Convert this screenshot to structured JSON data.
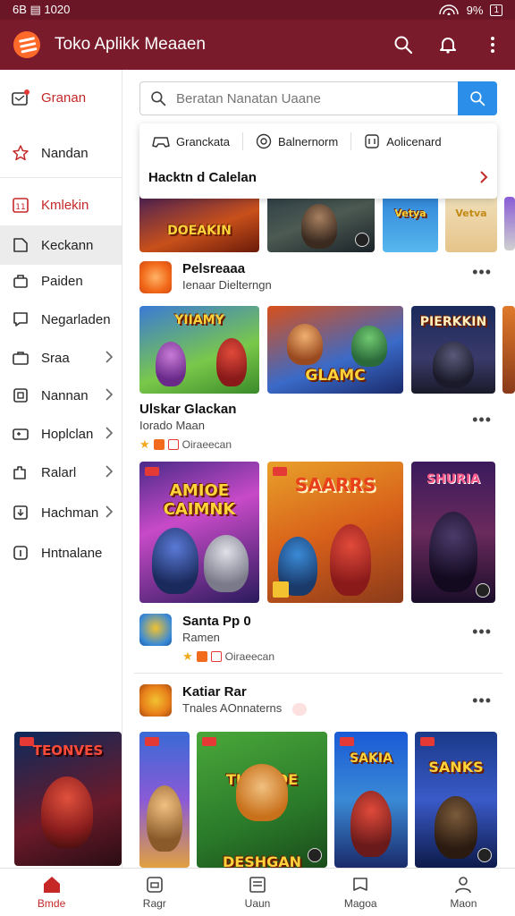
{
  "status": {
    "left": "6B ▤ 1020",
    "battery": "9%",
    "battery_badge": "1"
  },
  "app": {
    "title": "Toko Aplikk Meaaen"
  },
  "sidebar": {
    "items": [
      {
        "label": "Granan"
      },
      {
        "label": "Nandan"
      },
      {
        "label": "Kmlekin"
      },
      {
        "label": "Keckann"
      },
      {
        "label": "Paiden"
      },
      {
        "label": "Negarladen"
      },
      {
        "label": "Sraa"
      },
      {
        "label": "Nannan"
      },
      {
        "label": "Hoplclan"
      },
      {
        "label": "Ralarl"
      },
      {
        "label": "Hachman"
      },
      {
        "label": "Hntnalane"
      }
    ],
    "promo_title": "TEONVES"
  },
  "search": {
    "placeholder": "Beratan Nanatan Uaane"
  },
  "dropdown": {
    "chips": [
      "Granckata",
      "Balnernorm",
      "Aolicenard"
    ],
    "link": "Hacktn d Calelan"
  },
  "tiles": {
    "row1": [
      "DOEAKIN",
      "",
      "Vetya",
      "Vetva"
    ],
    "row2": [
      "YIIAMY",
      "GLAMC",
      "PIERKKIN",
      ""
    ],
    "row3": [
      "AMIOE CAIMNK",
      "SAARRS",
      "SHURIA"
    ],
    "row4": [
      "",
      "TKONIOE DESHGAN",
      "SAKIA",
      "SANKS"
    ]
  },
  "apps": [
    {
      "name": "Pelsreaaa",
      "sub": "Ienaar Dielterngn",
      "rating": ""
    },
    {
      "name": "Ulskar Glackan",
      "sub": "Iorado Maan",
      "rating": "Oiraeecan"
    },
    {
      "name": "Santa Pp 0",
      "sub": "Ramen",
      "rating": "Oiraeecan"
    },
    {
      "name": "Katiar Rar",
      "sub": "Tnales AOnnaterns",
      "rating": ""
    }
  ],
  "bottom_nav": [
    {
      "label": "Bmde"
    },
    {
      "label": "Ragr"
    },
    {
      "label": "Uaun"
    },
    {
      "label": "Magoa"
    },
    {
      "label": "Maon"
    }
  ],
  "colors": {
    "appbar": "#7a1b2c",
    "statusbar": "#6a1626",
    "accent": "#c62828",
    "search_button": "#2b8ee8"
  }
}
